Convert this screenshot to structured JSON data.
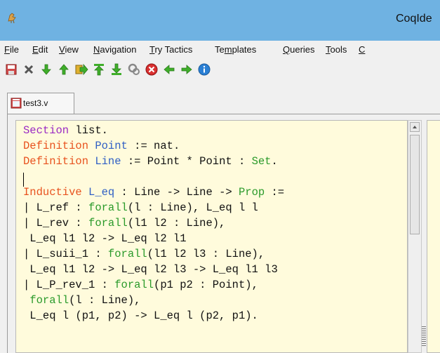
{
  "window": {
    "title": "CoqIde",
    "app_icon": "coq-rooster-icon"
  },
  "menu": {
    "items": [
      {
        "underline": "F",
        "rest": "ile"
      },
      {
        "underline": "E",
        "rest": "dit"
      },
      {
        "underline": "V",
        "rest": "iew"
      },
      {
        "underline": "N",
        "rest": "avigation"
      },
      {
        "underline": "T",
        "rest": "ry Tactics"
      },
      {
        "pre": "Te",
        "underline": "m",
        "rest": "plates"
      },
      {
        "underline": "Q",
        "rest": "ueries"
      },
      {
        "underline": "T",
        "rest": "ools"
      },
      {
        "underline": "C",
        "rest": ""
      }
    ]
  },
  "toolbar": {
    "buttons": [
      "save-icon",
      "close-icon",
      "forward-one-icon",
      "backward-one-icon",
      "go-to-cursor-icon",
      "restart-icon",
      "go-to-end-icon",
      "interrupt-icon",
      "stop-icon",
      "previous-occurrence-icon",
      "next-occurrence-icon",
      "about-icon"
    ],
    "colors": {
      "green": "#3fae2a",
      "red": "#d93030",
      "blue": "#2a7fd4",
      "save": "#d24a4a"
    }
  },
  "tab": {
    "label": "test3.v"
  },
  "editor": {
    "background": "#fffbdc",
    "lines": [
      [
        {
          "t": "Section",
          "c": "kw-purple"
        },
        {
          "t": " list."
        }
      ],
      [
        {
          "t": "Definition",
          "c": "kw-orange"
        },
        {
          "t": " "
        },
        {
          "t": "Point",
          "c": "ident"
        },
        {
          "t": " := nat."
        }
      ],
      [
        {
          "t": "Definition",
          "c": "kw-orange"
        },
        {
          "t": " "
        },
        {
          "t": "Line",
          "c": "ident"
        },
        {
          "t": " := Point * Point : "
        },
        {
          "t": "Set",
          "c": "kw-green"
        },
        {
          "t": "."
        }
      ],
      [
        {
          "t": ""
        }
      ],
      [
        {
          "t": "Inductive",
          "c": "kw-orange"
        },
        {
          "t": " "
        },
        {
          "t": "L_eq",
          "c": "ident"
        },
        {
          "t": " : Line -> Line -> "
        },
        {
          "t": "Prop",
          "c": "kw-green"
        },
        {
          "t": " :="
        }
      ],
      [
        {
          "t": "| L_ref : "
        },
        {
          "t": "forall",
          "c": "kw-green"
        },
        {
          "t": "(l : Line), L_eq l l"
        }
      ],
      [
        {
          "t": "| L_rev : "
        },
        {
          "t": "forall",
          "c": "kw-green"
        },
        {
          "t": "(l1 l2 : Line),"
        }
      ],
      [
        {
          "t": " L_eq l1 l2 -> L_eq l2 l1"
        }
      ],
      [
        {
          "t": "| L_suii_1 : "
        },
        {
          "t": "forall",
          "c": "kw-green"
        },
        {
          "t": "(l1 l2 l3 : Line),"
        }
      ],
      [
        {
          "t": " L_eq l1 l2 -> L_eq l2 l3 -> L_eq l1 l3"
        }
      ],
      [
        {
          "t": "| L_P_rev_1 : "
        },
        {
          "t": "forall",
          "c": "kw-green"
        },
        {
          "t": "(p1 p2 : Point),"
        }
      ],
      [
        {
          "t": " "
        },
        {
          "t": "forall",
          "c": "kw-green"
        },
        {
          "t": "(l : Line),"
        }
      ],
      [
        {
          "t": " L_eq l (p1, p2) -> L_eq l (p2, p1)."
        }
      ]
    ]
  }
}
